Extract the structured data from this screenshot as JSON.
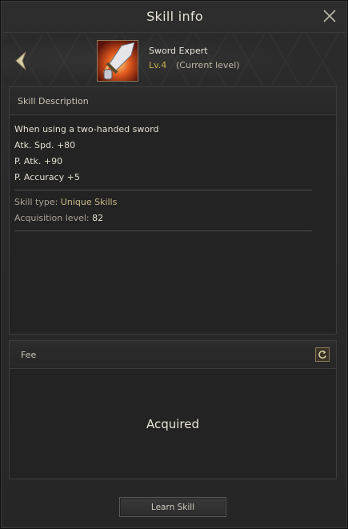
{
  "window": {
    "title": "Skill info"
  },
  "icons": {
    "close": "close-icon",
    "back": "chevron-left-icon",
    "skill": "sword-skill-icon",
    "refresh": "refresh-icon"
  },
  "colors": {
    "level": "#c8b04a",
    "skill_type": "#c8b98a",
    "background": "#2a2a2a"
  },
  "skill": {
    "name": "Sword Expert",
    "level": "Lv.4",
    "level_note": "(Current level)"
  },
  "description": {
    "header": "Skill Description",
    "lines": [
      "When using a two-handed sword",
      "Atk. Spd. +80",
      "P. Atk. +90",
      "P. Accuracy +5"
    ],
    "skill_type_label": "Skill type: ",
    "skill_type_value": "Unique Skills",
    "acquisition_label": "Acquisition level: ",
    "acquisition_value": "82"
  },
  "fee": {
    "header": "Fee",
    "status": "Acquired"
  },
  "actions": {
    "learn_label": "Learn Skill"
  }
}
